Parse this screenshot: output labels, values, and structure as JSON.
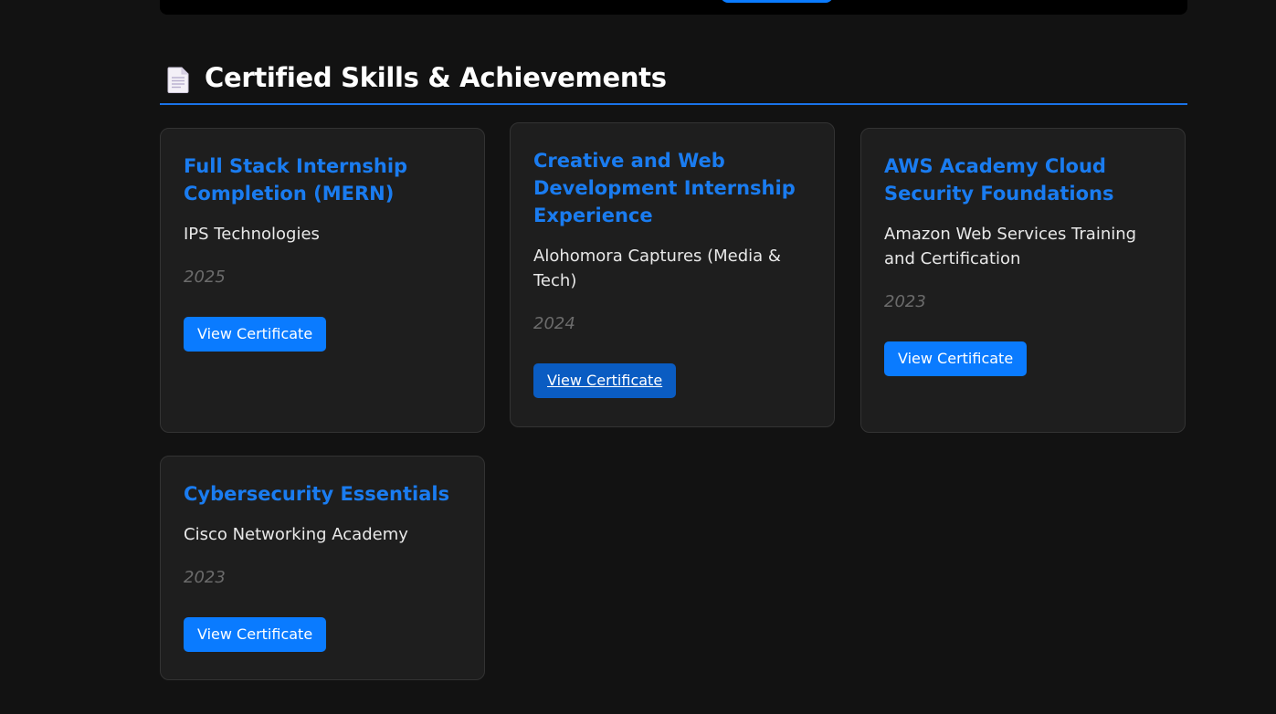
{
  "section": {
    "title": "Certified Skills & Achievements",
    "icon": "document-icon"
  },
  "cards": [
    {
      "title": "Full Stack Internship Completion (MERN)",
      "issuer": "IPS Technologies",
      "year": "2025",
      "button_label": "View Certificate"
    },
    {
      "title": "Creative and Web Development Internship Experience",
      "issuer": "Alohomora Captures (Media & Tech)",
      "year": "2024",
      "button_label": "View Certificate"
    },
    {
      "title": "AWS Academy Cloud Security Foundations",
      "issuer": "Amazon Web Services Training and Certification",
      "year": "2023",
      "button_label": "View Certificate"
    },
    {
      "title": "Cybersecurity Essentials",
      "issuer": "Cisco Networking Academy",
      "year": "2023",
      "button_label": "View Certificate"
    }
  ],
  "colors": {
    "accent": "#0a7bff",
    "title": "#1a7cf0",
    "card_bg": "#1e1e1e",
    "page_bg": "#121212"
  }
}
